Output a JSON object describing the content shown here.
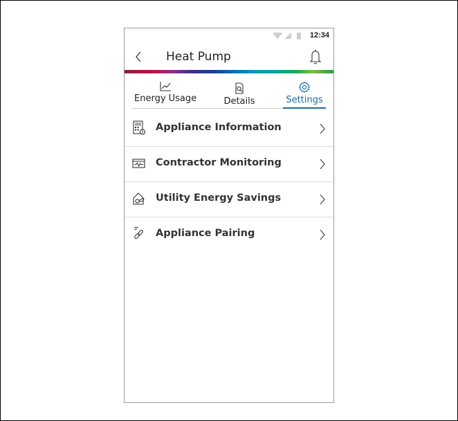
{
  "status_bar": {
    "time": "12:34"
  },
  "app_bar": {
    "title": "Heat Pump"
  },
  "tabs": [
    {
      "label": "Energy Usage",
      "icon": "chart-line-icon",
      "active": false
    },
    {
      "label": "Details",
      "icon": "document-search-icon",
      "active": false
    },
    {
      "label": "Settings",
      "icon": "gear-icon",
      "active": true
    }
  ],
  "settings_list": [
    {
      "label": "Appliance Information",
      "icon": "appliance-info-icon"
    },
    {
      "label": "Contractor Monitoring",
      "icon": "monitor-pulse-icon"
    },
    {
      "label": "Utility Energy Savings",
      "icon": "house-leaf-icon"
    },
    {
      "label": "Appliance Pairing",
      "icon": "link-pairing-icon"
    }
  ],
  "colors": {
    "accent": "#1a6aa6",
    "text": "#222222",
    "divider": "#dcdcdc"
  }
}
